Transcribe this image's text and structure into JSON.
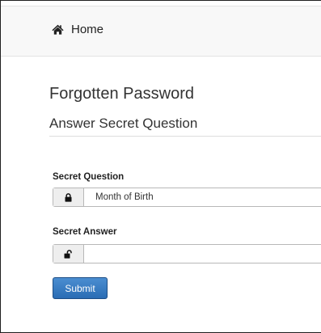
{
  "nav": {
    "home_label": "Home",
    "home_icon": "home-icon"
  },
  "page": {
    "title": "Forgotten Password",
    "subtitle": "Answer Secret Question"
  },
  "form": {
    "question": {
      "label": "Secret Question",
      "value": "Month of Birth",
      "icon": "lock-icon"
    },
    "answer": {
      "label": "Secret Answer",
      "value": "",
      "icon": "unlock-icon"
    },
    "submit_label": "Submit"
  },
  "colors": {
    "primary_button": "#2a6cb4",
    "navbar_background": "#f8f8f8"
  }
}
